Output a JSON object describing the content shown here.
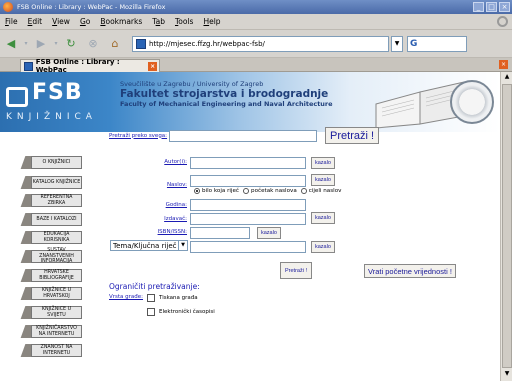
{
  "window": {
    "title": "FSB Online : Library : WebPac - Mozilla Firefox"
  },
  "menu": [
    {
      "pre": "",
      "u": "F",
      "post": "ile"
    },
    {
      "pre": "",
      "u": "E",
      "post": "dit"
    },
    {
      "pre": "",
      "u": "V",
      "post": "iew"
    },
    {
      "pre": "",
      "u": "G",
      "post": "o"
    },
    {
      "pre": "",
      "u": "B",
      "post": "ookmarks"
    },
    {
      "pre": "T",
      "u": "a",
      "post": "b"
    },
    {
      "pre": "",
      "u": "T",
      "post": "ools"
    },
    {
      "pre": "",
      "u": "H",
      "post": "elp"
    }
  ],
  "nav": {
    "url": "http://mjesec.ffzg.hr/webpac-fsb/"
  },
  "tab": {
    "label": "FSB Online : Library : WebPac"
  },
  "header": {
    "logo": "FSB",
    "subtitle_logo": "KNJIŽNICA",
    "line1": "Sveučilište u Zagrebu / University of Zagreb",
    "line2": "Fakultet strojarstva i brodogradnje",
    "line3": "Faculty of Mechanical Engineering and Naval Architecture"
  },
  "search_all": {
    "label": "Pretraži preko svega:",
    "button": "Pretraži !"
  },
  "sidebar": [
    "O KNJIŽNICI",
    "KATALOG KNJIŽNICE",
    "REFERENTNA ZBIRKA",
    "BAZE I KATALOZI",
    "EDUKACIJA KORISNIKA",
    "SUSTAV ZNANSTVENIH INFORMACIJA",
    "HRVATSKE BIBLIOGRAFIJE",
    "KNJIŽNICE U HRVATSKOJ",
    "KNJIŽNICE U SVIJETU",
    "KNJIŽNIČARSTVO NA INTERNETU",
    "ZNANOST NA INTERNETU"
  ],
  "form": {
    "autori": "Autor(i):",
    "naslov": "Naslov:",
    "radio": [
      "bilo koja riječ",
      "početak naslova",
      "cijeli naslov"
    ],
    "godina": "Godina:",
    "izdavac": "Izdavač:",
    "isbn": "ISBN/ISSN:",
    "tema_select": "Tema/Ključna riječ",
    "kazalo": "kazalo",
    "submit": "Pretraži !",
    "reset": "Vrati početne vrijednosti !",
    "ograniciti": "Ograničiti pretraživanje:",
    "vrsta": "Vrsta građe:",
    "checks": [
      "Tiskana građa",
      "Elektronički časopisi"
    ]
  }
}
